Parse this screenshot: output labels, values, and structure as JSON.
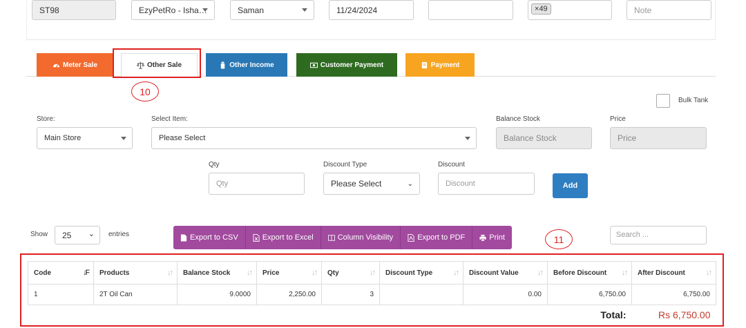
{
  "top_row": {
    "station_code": "ST98",
    "customer": "EzyPetRo - Isha…",
    "employee": "Saman",
    "date": "11/24/2024",
    "blank_field": "",
    "tag_label": "49",
    "note_placeholder": "Note"
  },
  "tabs": [
    {
      "label": "Meter Sale",
      "color": "#f26a2e",
      "icon": "meter-icon"
    },
    {
      "label": "Other Sale",
      "color": "#ffffff",
      "icon": "scale-icon"
    },
    {
      "label": "Other Income",
      "color": "#2978b5",
      "icon": "bottle-icon"
    },
    {
      "label": "Customer Payment",
      "color": "#2e6b21",
      "icon": "money-icon"
    },
    {
      "label": "Payment",
      "color": "#f7a521",
      "icon": "book-icon"
    }
  ],
  "annotations": {
    "tab_marker": "10",
    "table_marker": "11"
  },
  "form": {
    "bulk_tank_label": "Bulk Tank",
    "store_label": "Store:",
    "store_value": "Main Store",
    "item_label": "Select Item:",
    "item_value": "Please Select",
    "balance_label": "Balance Stock",
    "balance_placeholder": "Balance Stock",
    "price_label": "Price",
    "price_placeholder": "Price",
    "qty_label": "Qty",
    "qty_placeholder": "Qty",
    "discount_type_label": "Discount Type",
    "discount_type_value": "Please Select",
    "discount_label": "Discount",
    "discount_placeholder": "Discount",
    "add_button": "Add"
  },
  "datatable": {
    "show_label": "Show",
    "page_size": "25",
    "entries_label": "entries",
    "buttons": [
      "Export to CSV",
      "Export to Excel",
      "Column Visibility",
      "Export to PDF",
      "Print"
    ],
    "search_placeholder": "Search ...",
    "columns": [
      "Code",
      "Products",
      "Balance Stock",
      "Price",
      "Qty",
      "Discount Type",
      "Discount Value",
      "Before Discount",
      "After Discount"
    ],
    "rows": [
      [
        "1",
        "2T Oil Can",
        "9.0000",
        "2,250.00",
        "3",
        "",
        "0.00",
        "6,750.00",
        "6,750.00"
      ]
    ],
    "total_label": "Total:",
    "total_value": "Rs 6,750.00"
  },
  "colors": {
    "accent_purple": "#a14a9e",
    "add_blue": "#2f7ec1",
    "annotation_red": "#e02020"
  }
}
